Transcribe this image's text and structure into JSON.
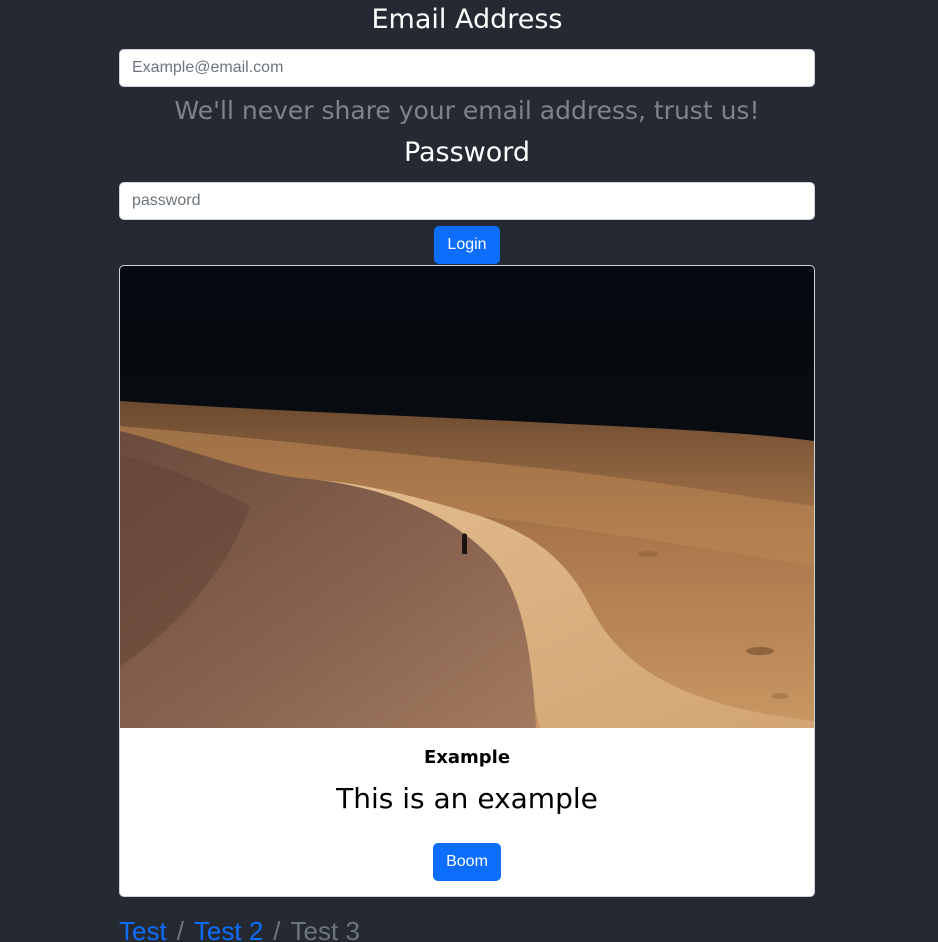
{
  "form": {
    "email_label": "Email Address",
    "email_placeholder": "Example@email.com",
    "email_help": "We'll never share your email address, trust us!",
    "password_label": "Password",
    "password_placeholder": "password",
    "login_label": "Login"
  },
  "card": {
    "image_icon": "desert-dune-photo",
    "title": "Example",
    "text": "This is an example",
    "button_label": "Boom"
  },
  "breadcrumb": {
    "items": [
      "Test",
      "Test 2",
      "Test 3"
    ],
    "separator": "/"
  },
  "colors": {
    "background": "#252932",
    "primary": "#0d6efd",
    "muted": "#6c757d"
  }
}
